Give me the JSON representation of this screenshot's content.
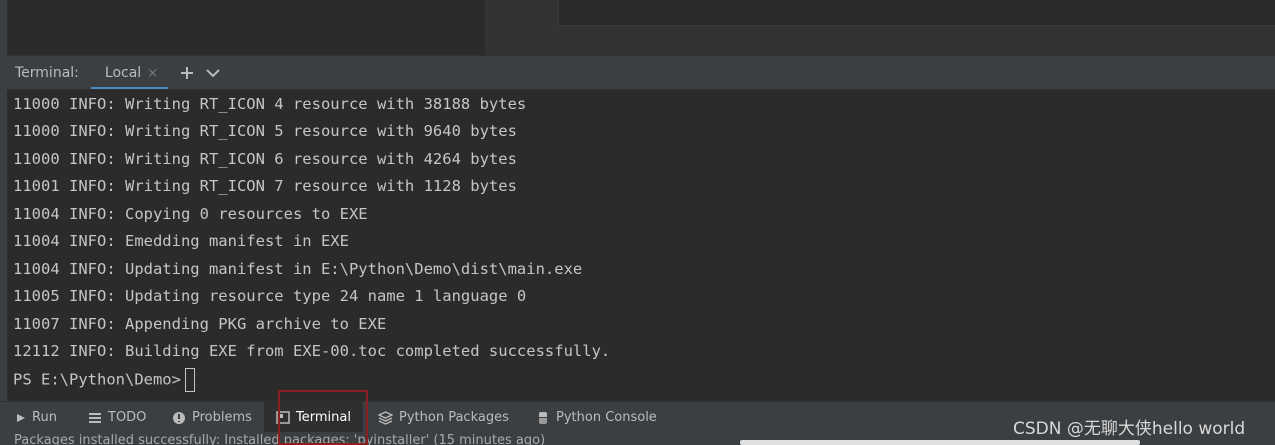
{
  "terminal": {
    "title": "Terminal:",
    "active_tab": "Local",
    "close_glyph": "×",
    "add_glyph": "+",
    "lines": [
      "11000 INFO: Writing RT_ICON 4 resource with 38188 bytes",
      "11000 INFO: Writing RT_ICON 5 resource with 9640 bytes",
      "11000 INFO: Writing RT_ICON 6 resource with 4264 bytes",
      "11001 INFO: Writing RT_ICON 7 resource with 1128 bytes",
      "11004 INFO: Copying 0 resources to EXE",
      "11004 INFO: Emedding manifest in EXE",
      "11004 INFO: Updating manifest in E:\\Python\\Demo\\dist\\main.exe",
      "11005 INFO: Updating resource type 24 name 1 language 0",
      "11007 INFO: Appending PKG archive to EXE",
      "12112 INFO: Building EXE from EXE-00.toc completed successfully."
    ],
    "prompt": "PS E:\\Python\\Demo>"
  },
  "tool_windows": [
    {
      "label": "Run",
      "icon": "run-icon"
    },
    {
      "label": "TODO",
      "icon": "todo-icon"
    },
    {
      "label": "Problems",
      "icon": "problems-icon"
    },
    {
      "label": "Terminal",
      "icon": "terminal-icon",
      "active": true
    },
    {
      "label": "Python Packages",
      "icon": "python-packages-icon"
    },
    {
      "label": "Python Console",
      "icon": "python-console-icon"
    }
  ],
  "status_bar": {
    "message": "Packages installed successfully: Installed packages: 'pyinstaller' (15 minutes ago)"
  },
  "watermark": "CSDN @无聊大侠hello world",
  "colors": {
    "background": "#2b2b2b",
    "panel": "#3c3f41",
    "accent": "#4a88c7",
    "highlight_box": "#8c1e22"
  }
}
